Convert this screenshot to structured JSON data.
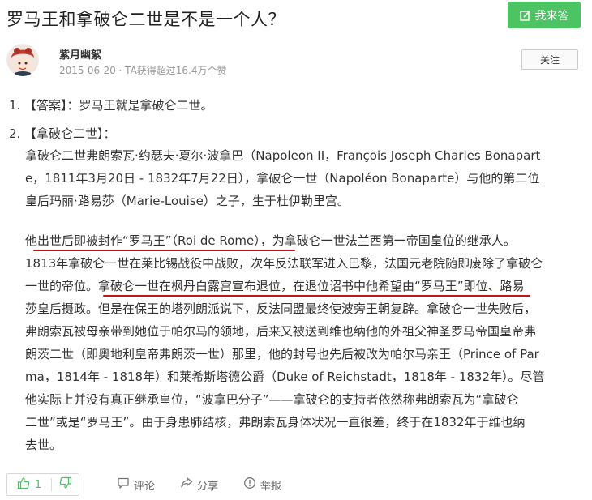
{
  "question": {
    "title": "罗马王和拿破仑二世是不是一个人？",
    "answer_button_label": "我来答"
  },
  "author": {
    "name": "紫月幽絮",
    "meta": "2015-06-20 · TA获得超过16.4万个赞",
    "follow_label": "关注"
  },
  "answer": {
    "item1": {
      "num": "1.",
      "text": "【答案】：罗马王就是拿破仑二世。"
    },
    "item2": {
      "num": "2.",
      "heading": "【拿破仑二世】：",
      "para1": [
        "拿破仑二世弗朗索瓦·约瑟夫·夏尔·波拿巴（Napoleon II，François Joseph Charles Bonapart",
        "e，1811年3月20日 - 1832年7月22日），拿破仑一世（Napoléon Bonaparte）与他的第二位",
        "皇后玛丽·路易莎（Marie-Louise）之子，生于杜伊勒里宫。"
      ],
      "para2": [
        "他出世后即被封作“罗马王”（Roi de Rome），为拿破仑一世法兰西第一帝国皇位的继承人。",
        "1813年拿破仑一世在莱比锡战役中战败，次年反法联军进入巴黎，法国元老院随即废除了拿破仑",
        "一世的帝位。拿破仑一世在枫丹白露宫宣布退位，在退位诏书中他希望由“罗马王”即位、路易",
        "莎皇后摄政。但是在保王的塔列朗派说下，反法同盟最终使波旁王朝复辟。拿破仑一世失败后，",
        "弗朗索瓦被母亲带到她位于帕尔马的领地，后来又被送到维也纳他的外祖父神圣罗马帝国皇帝弗",
        "朗茨二世（即奥地利皇帝弗朗茨一世）那里，他的封号也先后被改为帕尔马亲王（Prince of Par",
        "ma，1814年 - 1818年）和莱希斯塔德公爵（Duke of Reichstadt，1818年 - 1832年）。尽管",
        "他实际上并没有真正继承皇位，“波拿巴分子”——拿破仑的支持者依然称弗朗索瓦为“拿破仑",
        "二世”或是“罗马王”。由于身患肺结核，弗朗索瓦身体状况一直很差，终于在1832年于维也纳",
        "去世。"
      ]
    }
  },
  "footer": {
    "upvote_count": "1",
    "comment_label": "评论",
    "share_label": "分享",
    "report_label": "举报"
  },
  "colors": {
    "accent_green": "#4dc464",
    "annotation_red": "#c0161b"
  }
}
